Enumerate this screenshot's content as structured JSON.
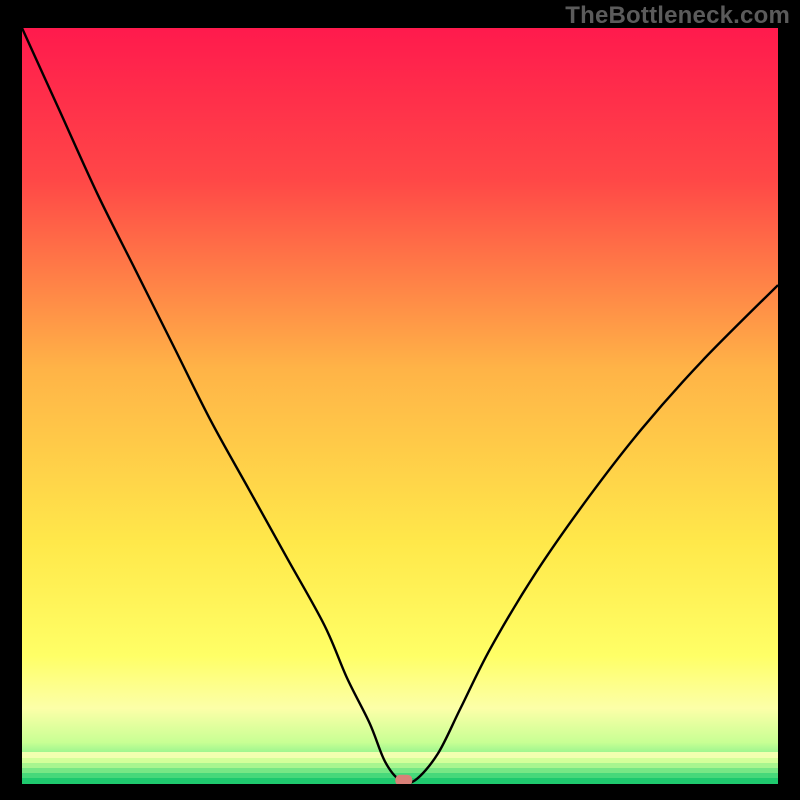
{
  "watermark": "TheBottleneck.com",
  "chart_data": {
    "type": "line",
    "title": "",
    "xlabel": "",
    "ylabel": "",
    "xlim": [
      0,
      100
    ],
    "ylim": [
      0,
      100
    ],
    "grid": false,
    "legend": false,
    "series": [
      {
        "name": "bottleneck-curve",
        "x": [
          0,
          5,
          10,
          15,
          20,
          25,
          30,
          35,
          40,
          43,
          46,
          48,
          50,
          52,
          55,
          58,
          62,
          68,
          75,
          82,
          90,
          100
        ],
        "y": [
          100,
          89,
          78,
          68,
          58,
          48,
          39,
          30,
          21,
          14,
          8,
          3,
          0.5,
          0.5,
          4,
          10,
          18,
          28,
          38,
          47,
          56,
          66
        ]
      }
    ],
    "marker": {
      "name": "optimal-point",
      "x": 50.5,
      "y": 0.5,
      "color": "#d98078"
    },
    "background_gradient": {
      "type": "vertical",
      "stops": [
        {
          "at": 0.0,
          "color": "#ff1a4d"
        },
        {
          "at": 0.2,
          "color": "#ff4747"
        },
        {
          "at": 0.45,
          "color": "#ffb347"
        },
        {
          "at": 0.68,
          "color": "#ffe84a"
        },
        {
          "at": 0.83,
          "color": "#ffff66"
        },
        {
          "at": 0.9,
          "color": "#fcffa8"
        },
        {
          "at": 0.945,
          "color": "#c8ff94"
        },
        {
          "at": 0.975,
          "color": "#66e989"
        },
        {
          "at": 1.0,
          "color": "#1fc96e"
        }
      ]
    },
    "bottom_bands": [
      {
        "color": "#1fc96e",
        "height": 6
      },
      {
        "color": "#46d87a",
        "height": 5
      },
      {
        "color": "#77e785",
        "height": 5
      },
      {
        "color": "#a7f58f",
        "height": 5
      },
      {
        "color": "#d3ff9a",
        "height": 5
      },
      {
        "color": "#f2ffb0",
        "height": 6
      }
    ]
  }
}
